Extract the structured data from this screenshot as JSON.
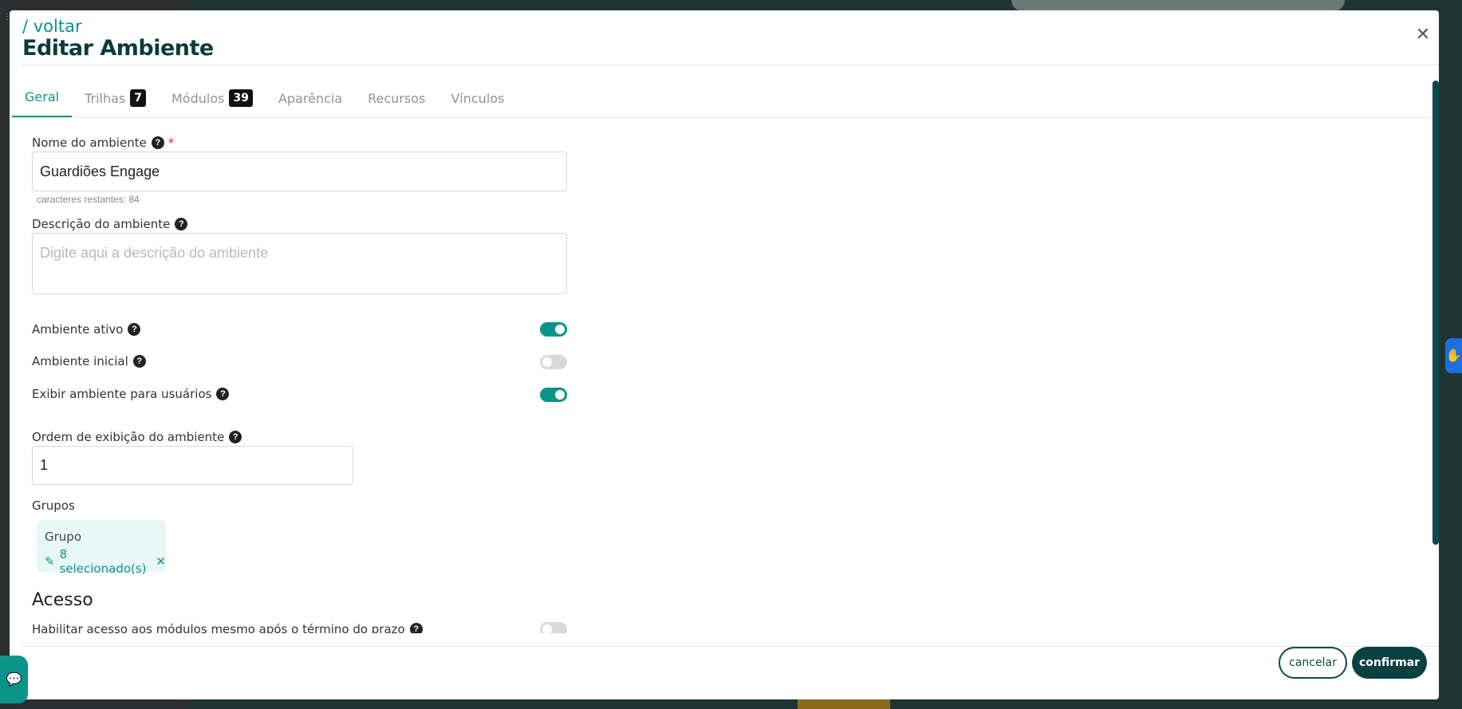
{
  "modal": {
    "back_link": "/ voltar",
    "title": "Editar Ambiente",
    "close_icon": "close-icon"
  },
  "tabs": [
    {
      "label": "Geral",
      "badge": ""
    },
    {
      "label": "Trilhas",
      "badge": "7"
    },
    {
      "label": "Módulos",
      "badge": "39"
    },
    {
      "label": "Aparência",
      "badge": ""
    },
    {
      "label": "Recursos",
      "badge": ""
    },
    {
      "label": "Vínculos",
      "badge": ""
    }
  ],
  "form": {
    "name_label": "Nome do ambiente",
    "name_required": "*",
    "name_value": "Guardiões Engage",
    "name_helper": "caracteres restantes: 84",
    "description_label": "Descrição do ambiente",
    "description_placeholder": "Digite aqui a descrição do ambiente",
    "toggles": [
      {
        "label": "Ambiente ativo",
        "on": true
      },
      {
        "label": "Ambiente inicial",
        "on": false
      },
      {
        "label": "Exibir ambiente para usuários",
        "on": true
      }
    ],
    "order_label": "Ordem de exibição do ambiente",
    "order_value": "1",
    "groups_label": "Grupos",
    "group_card_title": "Grupo",
    "group_selected": "8 selecionado(s)",
    "access_section_title": "Acesso",
    "access_toggle_label": "Habilitar acesso aos módulos mesmo após o término do prazo",
    "access_toggle_on": false
  },
  "footer": {
    "cancel_label": "cancelar",
    "confirm_label": "confirmar"
  },
  "colors": {
    "accent": "#0d9488",
    "dark": "#0b4040"
  }
}
